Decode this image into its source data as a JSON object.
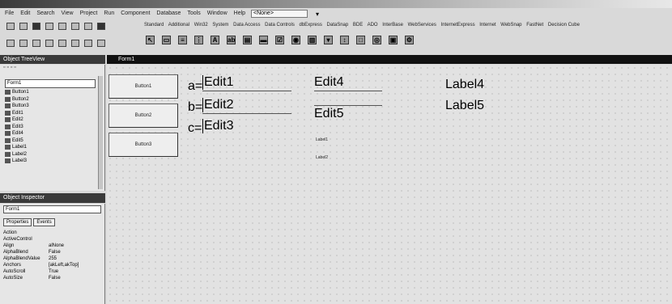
{
  "ide": {
    "menus": [
      "File",
      "Edit",
      "Search",
      "View",
      "Project",
      "Run",
      "Component",
      "Database",
      "Tools",
      "Window",
      "Help"
    ],
    "config_combo": "<None>"
  },
  "palette": {
    "tabs": [
      "Standard",
      "Additional",
      "Win32",
      "System",
      "Data Access",
      "Data Controls",
      "dbExpress",
      "DataSnap",
      "BDE",
      "ADO",
      "InterBase",
      "WebServices",
      "InternetExpress",
      "Internet",
      "WebSnap",
      "FastNet",
      "Decision Cube"
    ],
    "icons": [
      "pointer-icon",
      "frame-icon",
      "mainmenu-icon",
      "popupmenu-icon",
      "label-icon",
      "edit-icon",
      "memo-icon",
      "button-icon",
      "checkbox-icon",
      "radiobutton-icon",
      "listbox-icon",
      "combobox-icon",
      "scrollbar-icon",
      "groupbox-icon",
      "radiogroup-icon",
      "panel-icon",
      "actionlist-icon"
    ]
  },
  "object_tree": {
    "title": "Object TreeView",
    "root": "Form1",
    "items": [
      "Button1",
      "Button2",
      "Button3",
      "Edit1",
      "Edit2",
      "Edit3",
      "Edit4",
      "Edit5",
      "Label1",
      "Label2",
      "Label3"
    ]
  },
  "inspector": {
    "title": "Object Inspector",
    "selected": "Form1",
    "tabs": [
      "Properties",
      "Events"
    ],
    "props": [
      {
        "k": "Action",
        "v": ""
      },
      {
        "k": "ActiveControl",
        "v": ""
      },
      {
        "k": "Align",
        "v": "alNone"
      },
      {
        "k": "AlphaBlend",
        "v": "False"
      },
      {
        "k": "AlphaBlendValue",
        "v": "255"
      },
      {
        "k": "Anchors",
        "v": "[akLeft,akTop]"
      },
      {
        "k": "AutoScroll",
        "v": "True"
      },
      {
        "k": "AutoSize",
        "v": "False"
      }
    ]
  },
  "form": {
    "caption": "Form1",
    "buttons": [
      "Button1",
      "Button2",
      "Button3"
    ],
    "labels_abc": [
      "a=",
      "b=",
      "c="
    ],
    "edits": [
      "Edit1",
      "Edit2",
      "Edit3",
      "Edit4",
      "Edit5"
    ],
    "labels_right": [
      "Label4",
      "Label5"
    ],
    "labels_small": [
      "Label1",
      "Label2"
    ]
  }
}
